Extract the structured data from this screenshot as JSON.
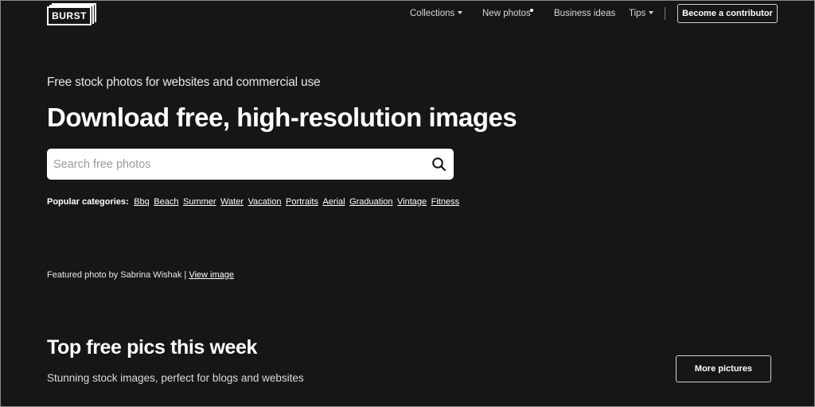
{
  "brand": {
    "logo_text": "BURST"
  },
  "nav": {
    "items": [
      {
        "label": "Collections",
        "has_dropdown": true
      },
      {
        "label": "New photos",
        "has_dot": true
      },
      {
        "label": "Business ideas"
      },
      {
        "label": "Tips",
        "has_dropdown": true
      }
    ],
    "contributor_button": "Become a contributor"
  },
  "hero": {
    "tagline": "Free stock photos for websites and commercial use",
    "headline": "Download free, high-resolution images",
    "search": {
      "placeholder": "Search free photos",
      "value": "",
      "icon": "search-icon"
    },
    "categories": {
      "label": "Popular categories:",
      "items": [
        "Bbq",
        "Beach",
        "Summer",
        "Water",
        "Vacation",
        "Portraits",
        "Aerial",
        "Graduation",
        "Vintage",
        "Fitness"
      ]
    },
    "featured": {
      "text": "Featured photo by Sabrina Wishak | ",
      "link": "View image"
    }
  },
  "section": {
    "title": "Top free pics this week",
    "subtitle": "Stunning stock images, perfect for blogs and websites",
    "more_button": "More pictures"
  },
  "colors": {
    "background": "#161616",
    "text": "#ffffff",
    "search_bg": "#ffffff"
  }
}
